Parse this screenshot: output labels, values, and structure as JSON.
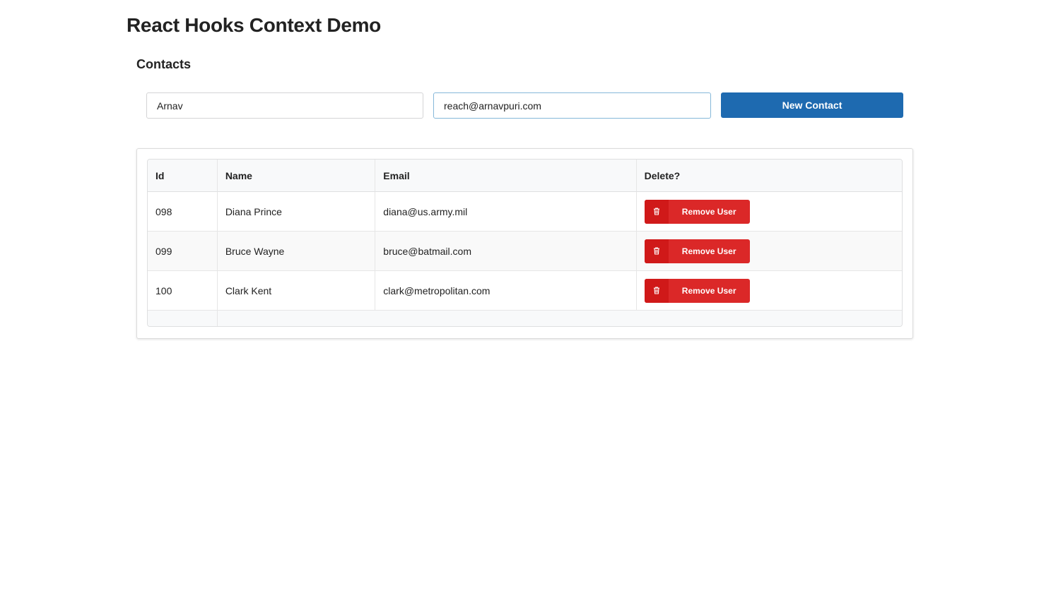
{
  "page": {
    "title": "React Hooks Context Demo"
  },
  "section": {
    "title": "Contacts"
  },
  "form": {
    "name_value": "Arnav",
    "email_value": "reach@arnavpuri.com",
    "submit_label": "New Contact"
  },
  "table": {
    "headers": [
      "Id",
      "Name",
      "Email",
      "Delete?"
    ],
    "rows": [
      {
        "id": "098",
        "name": "Diana Prince",
        "email": "diana@us.army.mil",
        "action": "Remove User"
      },
      {
        "id": "099",
        "name": "Bruce Wayne",
        "email": "bruce@batmail.com",
        "action": "Remove User"
      },
      {
        "id": "100",
        "name": "Clark Kent",
        "email": "clark@metropolitan.com",
        "action": "Remove User"
      }
    ]
  },
  "icons": {
    "remove": "trash-icon"
  },
  "colors": {
    "primary": "#1e6ab0",
    "danger": "#db2828",
    "danger_dark": "#d01919"
  }
}
